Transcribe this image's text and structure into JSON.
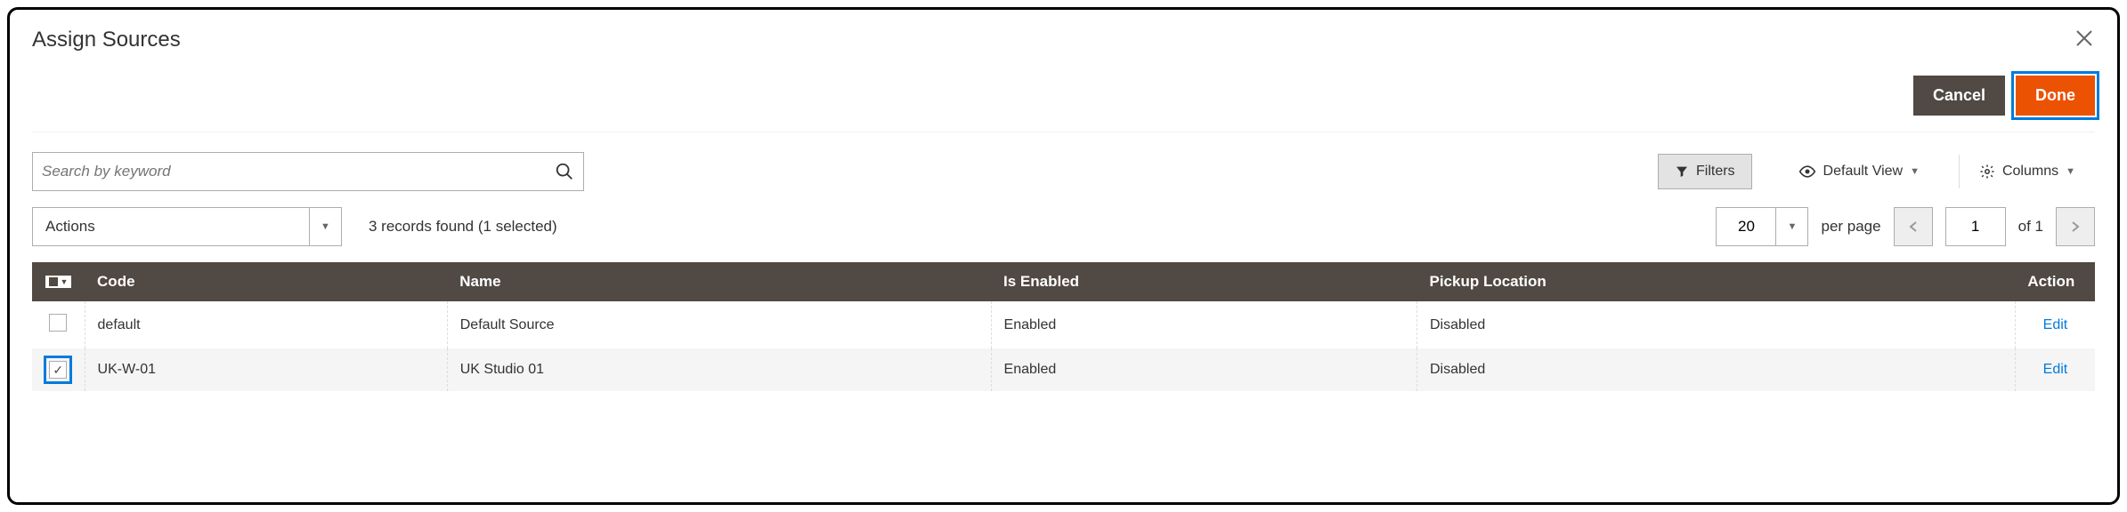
{
  "modal": {
    "title": "Assign Sources"
  },
  "buttons": {
    "cancel": "Cancel",
    "done": "Done"
  },
  "search": {
    "placeholder": "Search by keyword"
  },
  "toolbar": {
    "filters": "Filters",
    "default_view": "Default View",
    "columns": "Columns"
  },
  "actions": {
    "label": "Actions"
  },
  "records": {
    "text": "3 records found (1 selected)"
  },
  "pagination": {
    "page_size": "20",
    "per_page_label": "per page",
    "current": "1",
    "of_label": "of",
    "total": "1"
  },
  "grid": {
    "headers": {
      "code": "Code",
      "name": "Name",
      "enabled": "Is Enabled",
      "pickup": "Pickup Location",
      "action": "Action"
    },
    "rows": [
      {
        "selected": false,
        "code": "default",
        "name": "Default Source",
        "enabled": "Enabled",
        "pickup": "Disabled",
        "action": "Edit"
      },
      {
        "selected": true,
        "code": "UK-W-01",
        "name": "UK Studio 01",
        "enabled": "Enabled",
        "pickup": "Disabled",
        "action": "Edit"
      }
    ]
  }
}
